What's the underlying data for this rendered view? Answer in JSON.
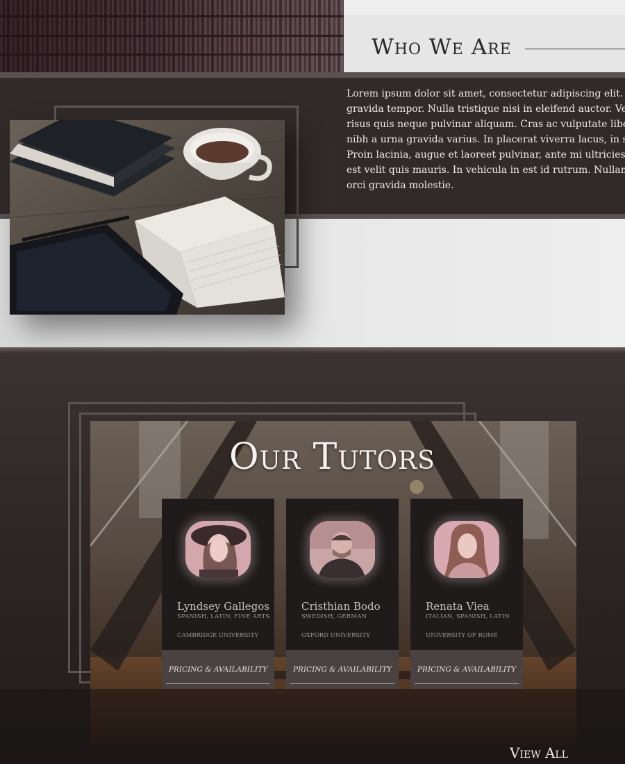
{
  "who_we_are": {
    "title": "Who We Are",
    "lines": [
      "Lorem ipsum dolor sit amet, consectetur adipiscing elit. Vestibulum",
      "gravida tempor. Nulla tristique nisi in eleifend auctor. Vestibulum",
      "risus quis neque pulvinar aliquam. Cras ac vulputate libero. Praesent",
      "nibh a urna gravida varius. In placerat viverra lacus, in sagittis",
      "Proin lacinia, augue et laoreet pulvinar, ante mi ultricies erat, vel",
      "est velit quis mauris. In vehicula in est id rutrum. Nullam non",
      "orci gravida molestie."
    ]
  },
  "tutors": {
    "title": "Our Tutors",
    "view_all": "View All",
    "cards": [
      {
        "name": "Lyndsey Gallegos",
        "languages": "SPANISH, LATIN, FINE ARTS",
        "school": "CAMBRIDGE UNIVERSITY",
        "pricing": "PRICING & AVAILABILITY"
      },
      {
        "name": "Cristhian Bodo",
        "languages": "SWEDISH, GERMAN",
        "school": "OXFORD UNIVERSITY",
        "pricing": "PRICING & AVAILABILITY"
      },
      {
        "name": "Renata Viea",
        "languages": "ITALIAN, SPANISH, LATIN",
        "school": "UNIVERSITY OF ROME",
        "pricing": "PRICING & AVAILABILITY"
      }
    ]
  },
  "colors": {
    "dark_band": "#302a28",
    "divider": "#5a5150",
    "light_band": "#e6e6e6",
    "card_bg": "#1f1b1a",
    "pricing_bg": "#4a4240"
  }
}
